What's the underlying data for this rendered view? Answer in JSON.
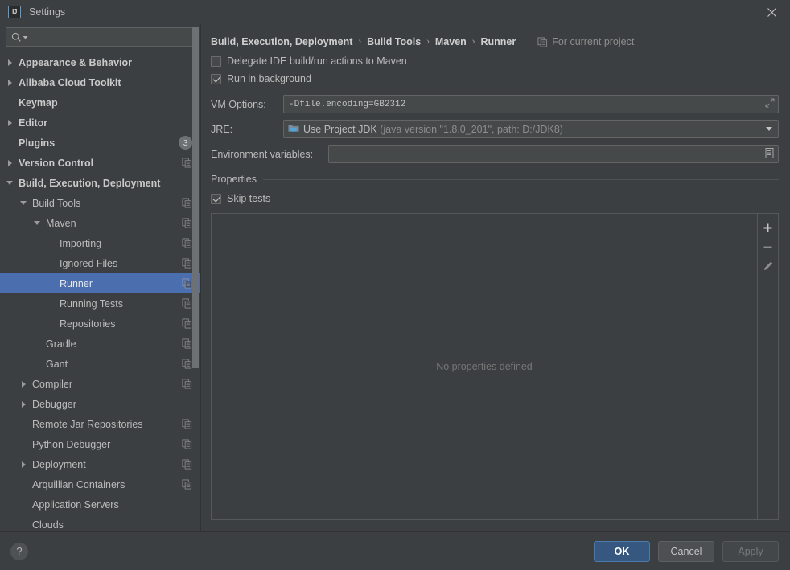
{
  "window": {
    "title": "Settings",
    "app_icon": "intellij-idea-icon",
    "close_icon": "close-icon"
  },
  "sidebar": {
    "search": {
      "placeholder": "",
      "value": "",
      "icon": "search-icon"
    },
    "items": [
      {
        "label": "Appearance & Behavior",
        "indent": 0,
        "arrow": "right",
        "bold": true,
        "copy": false,
        "badge": null,
        "selected": false
      },
      {
        "label": "Alibaba Cloud Toolkit",
        "indent": 0,
        "arrow": "right",
        "bold": true,
        "copy": false,
        "badge": null,
        "selected": false
      },
      {
        "label": "Keymap",
        "indent": 0,
        "arrow": "none",
        "bold": true,
        "copy": false,
        "badge": null,
        "selected": false
      },
      {
        "label": "Editor",
        "indent": 0,
        "arrow": "right",
        "bold": true,
        "copy": false,
        "badge": null,
        "selected": false
      },
      {
        "label": "Plugins",
        "indent": 0,
        "arrow": "none",
        "bold": true,
        "copy": false,
        "badge": "3",
        "selected": false
      },
      {
        "label": "Version Control",
        "indent": 0,
        "arrow": "right",
        "bold": true,
        "copy": true,
        "badge": null,
        "selected": false
      },
      {
        "label": "Build, Execution, Deployment",
        "indent": 0,
        "arrow": "down",
        "bold": true,
        "copy": false,
        "badge": null,
        "selected": false
      },
      {
        "label": "Build Tools",
        "indent": 1,
        "arrow": "down",
        "bold": false,
        "copy": true,
        "badge": null,
        "selected": false
      },
      {
        "label": "Maven",
        "indent": 2,
        "arrow": "down",
        "bold": false,
        "copy": true,
        "badge": null,
        "selected": false
      },
      {
        "label": "Importing",
        "indent": 3,
        "arrow": "none",
        "bold": false,
        "copy": true,
        "badge": null,
        "selected": false
      },
      {
        "label": "Ignored Files",
        "indent": 3,
        "arrow": "none",
        "bold": false,
        "copy": true,
        "badge": null,
        "selected": false
      },
      {
        "label": "Runner",
        "indent": 3,
        "arrow": "none",
        "bold": false,
        "copy": true,
        "badge": null,
        "selected": true
      },
      {
        "label": "Running Tests",
        "indent": 3,
        "arrow": "none",
        "bold": false,
        "copy": true,
        "badge": null,
        "selected": false
      },
      {
        "label": "Repositories",
        "indent": 3,
        "arrow": "none",
        "bold": false,
        "copy": true,
        "badge": null,
        "selected": false
      },
      {
        "label": "Gradle",
        "indent": 2,
        "arrow": "none",
        "bold": false,
        "copy": true,
        "badge": null,
        "selected": false
      },
      {
        "label": "Gant",
        "indent": 2,
        "arrow": "none",
        "bold": false,
        "copy": true,
        "badge": null,
        "selected": false
      },
      {
        "label": "Compiler",
        "indent": 1,
        "arrow": "right",
        "bold": false,
        "copy": true,
        "badge": null,
        "selected": false
      },
      {
        "label": "Debugger",
        "indent": 1,
        "arrow": "right",
        "bold": false,
        "copy": false,
        "badge": null,
        "selected": false
      },
      {
        "label": "Remote Jar Repositories",
        "indent": 1,
        "arrow": "none",
        "bold": false,
        "copy": true,
        "badge": null,
        "selected": false
      },
      {
        "label": "Python Debugger",
        "indent": 1,
        "arrow": "none",
        "bold": false,
        "copy": true,
        "badge": null,
        "selected": false
      },
      {
        "label": "Deployment",
        "indent": 1,
        "arrow": "right",
        "bold": false,
        "copy": true,
        "badge": null,
        "selected": false
      },
      {
        "label": "Arquillian Containers",
        "indent": 1,
        "arrow": "none",
        "bold": false,
        "copy": true,
        "badge": null,
        "selected": false
      },
      {
        "label": "Application Servers",
        "indent": 1,
        "arrow": "none",
        "bold": false,
        "copy": false,
        "badge": null,
        "selected": false
      },
      {
        "label": "Clouds",
        "indent": 1,
        "arrow": "none",
        "bold": false,
        "copy": false,
        "badge": null,
        "selected": false
      }
    ]
  },
  "main": {
    "breadcrumb": [
      "Build, Execution, Deployment",
      "Build Tools",
      "Maven",
      "Runner"
    ],
    "breadcrumb_separator": "›",
    "for_current_project": "For current project",
    "for_current_project_icon": "copy-icon",
    "checkboxes": [
      {
        "label": "Delegate IDE build/run actions to Maven",
        "checked": false
      },
      {
        "label": "Run in background",
        "checked": true
      }
    ],
    "vm_options": {
      "label": "VM Options:",
      "value": "-Dfile.encoding=GB2312",
      "expand_icon": "expand-icon"
    },
    "jre": {
      "label": "JRE:",
      "icon": "jdk-folder-icon",
      "value": "Use Project JDK",
      "detail": "(java version \"1.8.0_201\", path: D:/JDK8)",
      "dropdown_icon": "chevron-down-icon"
    },
    "env_vars": {
      "label": "Environment variables:",
      "value": "",
      "browse_icon": "list-edit-icon"
    },
    "properties_section": {
      "title": "Properties",
      "skip_tests": {
        "label": "Skip tests",
        "checked": true
      },
      "empty_text": "No properties defined",
      "toolbar": [
        {
          "name": "add-property-button",
          "icon": "plus-icon"
        },
        {
          "name": "remove-property-button",
          "icon": "minus-icon"
        },
        {
          "name": "edit-property-button",
          "icon": "pencil-icon"
        }
      ]
    }
  },
  "footer": {
    "help_label": "?",
    "ok_label": "OK",
    "cancel_label": "Cancel",
    "apply_label": "Apply"
  },
  "colors": {
    "background": "#3c3f41",
    "field_background": "#45494a",
    "selection": "#4b6eaf",
    "primary_button": "#365880",
    "text": "#bbbbbb",
    "muted_text": "#8d8d8d"
  }
}
